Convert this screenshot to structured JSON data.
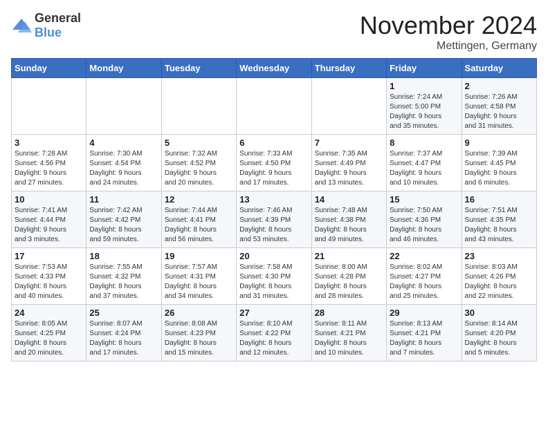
{
  "logo": {
    "text_general": "General",
    "text_blue": "Blue"
  },
  "header": {
    "month_title": "November 2024",
    "location": "Mettingen, Germany"
  },
  "days_of_week": [
    "Sunday",
    "Monday",
    "Tuesday",
    "Wednesday",
    "Thursday",
    "Friday",
    "Saturday"
  ],
  "weeks": [
    [
      {
        "day": "",
        "info": ""
      },
      {
        "day": "",
        "info": ""
      },
      {
        "day": "",
        "info": ""
      },
      {
        "day": "",
        "info": ""
      },
      {
        "day": "",
        "info": ""
      },
      {
        "day": "1",
        "info": "Sunrise: 7:24 AM\nSunset: 5:00 PM\nDaylight: 9 hours\nand 35 minutes."
      },
      {
        "day": "2",
        "info": "Sunrise: 7:26 AM\nSunset: 4:58 PM\nDaylight: 9 hours\nand 31 minutes."
      }
    ],
    [
      {
        "day": "3",
        "info": "Sunrise: 7:28 AM\nSunset: 4:56 PM\nDaylight: 9 hours\nand 27 minutes."
      },
      {
        "day": "4",
        "info": "Sunrise: 7:30 AM\nSunset: 4:54 PM\nDaylight: 9 hours\nand 24 minutes."
      },
      {
        "day": "5",
        "info": "Sunrise: 7:32 AM\nSunset: 4:52 PM\nDaylight: 9 hours\nand 20 minutes."
      },
      {
        "day": "6",
        "info": "Sunrise: 7:33 AM\nSunset: 4:50 PM\nDaylight: 9 hours\nand 17 minutes."
      },
      {
        "day": "7",
        "info": "Sunrise: 7:35 AM\nSunset: 4:49 PM\nDaylight: 9 hours\nand 13 minutes."
      },
      {
        "day": "8",
        "info": "Sunrise: 7:37 AM\nSunset: 4:47 PM\nDaylight: 9 hours\nand 10 minutes."
      },
      {
        "day": "9",
        "info": "Sunrise: 7:39 AM\nSunset: 4:45 PM\nDaylight: 9 hours\nand 6 minutes."
      }
    ],
    [
      {
        "day": "10",
        "info": "Sunrise: 7:41 AM\nSunset: 4:44 PM\nDaylight: 9 hours\nand 3 minutes."
      },
      {
        "day": "11",
        "info": "Sunrise: 7:42 AM\nSunset: 4:42 PM\nDaylight: 8 hours\nand 59 minutes."
      },
      {
        "day": "12",
        "info": "Sunrise: 7:44 AM\nSunset: 4:41 PM\nDaylight: 8 hours\nand 56 minutes."
      },
      {
        "day": "13",
        "info": "Sunrise: 7:46 AM\nSunset: 4:39 PM\nDaylight: 8 hours\nand 53 minutes."
      },
      {
        "day": "14",
        "info": "Sunrise: 7:48 AM\nSunset: 4:38 PM\nDaylight: 8 hours\nand 49 minutes."
      },
      {
        "day": "15",
        "info": "Sunrise: 7:50 AM\nSunset: 4:36 PM\nDaylight: 8 hours\nand 46 minutes."
      },
      {
        "day": "16",
        "info": "Sunrise: 7:51 AM\nSunset: 4:35 PM\nDaylight: 8 hours\nand 43 minutes."
      }
    ],
    [
      {
        "day": "17",
        "info": "Sunrise: 7:53 AM\nSunset: 4:33 PM\nDaylight: 8 hours\nand 40 minutes."
      },
      {
        "day": "18",
        "info": "Sunrise: 7:55 AM\nSunset: 4:32 PM\nDaylight: 8 hours\nand 37 minutes."
      },
      {
        "day": "19",
        "info": "Sunrise: 7:57 AM\nSunset: 4:31 PM\nDaylight: 8 hours\nand 34 minutes."
      },
      {
        "day": "20",
        "info": "Sunrise: 7:58 AM\nSunset: 4:30 PM\nDaylight: 8 hours\nand 31 minutes."
      },
      {
        "day": "21",
        "info": "Sunrise: 8:00 AM\nSunset: 4:28 PM\nDaylight: 8 hours\nand 28 minutes."
      },
      {
        "day": "22",
        "info": "Sunrise: 8:02 AM\nSunset: 4:27 PM\nDaylight: 8 hours\nand 25 minutes."
      },
      {
        "day": "23",
        "info": "Sunrise: 8:03 AM\nSunset: 4:26 PM\nDaylight: 8 hours\nand 22 minutes."
      }
    ],
    [
      {
        "day": "24",
        "info": "Sunrise: 8:05 AM\nSunset: 4:25 PM\nDaylight: 8 hours\nand 20 minutes."
      },
      {
        "day": "25",
        "info": "Sunrise: 8:07 AM\nSunset: 4:24 PM\nDaylight: 8 hours\nand 17 minutes."
      },
      {
        "day": "26",
        "info": "Sunrise: 8:08 AM\nSunset: 4:23 PM\nDaylight: 8 hours\nand 15 minutes."
      },
      {
        "day": "27",
        "info": "Sunrise: 8:10 AM\nSunset: 4:22 PM\nDaylight: 8 hours\nand 12 minutes."
      },
      {
        "day": "28",
        "info": "Sunrise: 8:11 AM\nSunset: 4:21 PM\nDaylight: 8 hours\nand 10 minutes."
      },
      {
        "day": "29",
        "info": "Sunrise: 8:13 AM\nSunset: 4:21 PM\nDaylight: 8 hours\nand 7 minutes."
      },
      {
        "day": "30",
        "info": "Sunrise: 8:14 AM\nSunset: 4:20 PM\nDaylight: 8 hours\nand 5 minutes."
      }
    ]
  ]
}
